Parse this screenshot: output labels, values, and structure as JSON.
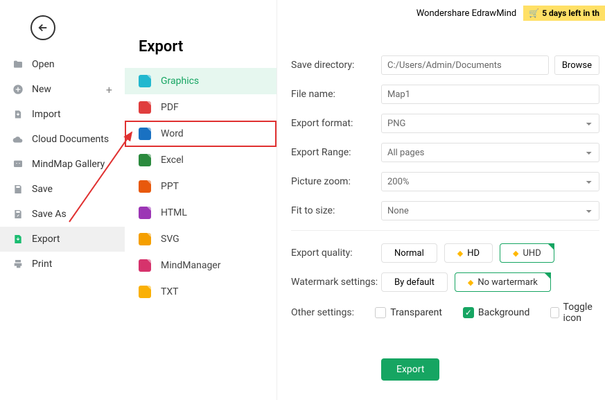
{
  "app_title": "Wondershare EdrawMind",
  "trial_text": "5 days left in th",
  "sidebar": {
    "items": [
      {
        "label": "Open",
        "icon": "folder"
      },
      {
        "label": "New",
        "icon": "plus-circle",
        "has_plus": true
      },
      {
        "label": "Import",
        "icon": "import"
      },
      {
        "label": "Cloud Documents",
        "icon": "cloud"
      },
      {
        "label": "MindMap Gallery",
        "icon": "gallery"
      },
      {
        "label": "Save",
        "icon": "save"
      },
      {
        "label": "Save As",
        "icon": "save-as"
      },
      {
        "label": "Export",
        "icon": "export",
        "active": true
      },
      {
        "label": "Print",
        "icon": "print"
      }
    ]
  },
  "export_panel": {
    "title": "Export",
    "formats": [
      {
        "label": "Graphics",
        "color": "cyan",
        "selected": true
      },
      {
        "label": "PDF",
        "color": "red"
      },
      {
        "label": "Word",
        "color": "blue",
        "highlighted": true
      },
      {
        "label": "Excel",
        "color": "green"
      },
      {
        "label": "PPT",
        "color": "orange"
      },
      {
        "label": "HTML",
        "color": "purple"
      },
      {
        "label": "SVG",
        "color": "yellow"
      },
      {
        "label": "MindManager",
        "color": "red2"
      },
      {
        "label": "TXT",
        "color": "amber"
      }
    ]
  },
  "settings": {
    "save_directory": {
      "label": "Save directory:",
      "value": "C:/Users/Admin/Documents",
      "browse": "Browse"
    },
    "file_name": {
      "label": "File name:",
      "value": "Map1"
    },
    "export_format": {
      "label": "Export format:",
      "value": "PNG"
    },
    "export_range": {
      "label": "Export Range:",
      "value": "All pages"
    },
    "picture_zoom": {
      "label": "Picture zoom:",
      "value": "200%"
    },
    "fit_to_size": {
      "label": "Fit to size:",
      "value": "None"
    },
    "export_quality": {
      "label": "Export quality:",
      "options": [
        "Normal",
        "HD",
        "UHD"
      ],
      "active": "UHD"
    },
    "watermark": {
      "label": "Watermark settings:",
      "options": [
        "By default",
        "No wartermark"
      ],
      "active": "No wartermark"
    },
    "other": {
      "label": "Other settings:",
      "transparent": "Transparent",
      "background": "Background",
      "toggle_icon": "Toggle icon"
    },
    "export_button": "Export"
  }
}
